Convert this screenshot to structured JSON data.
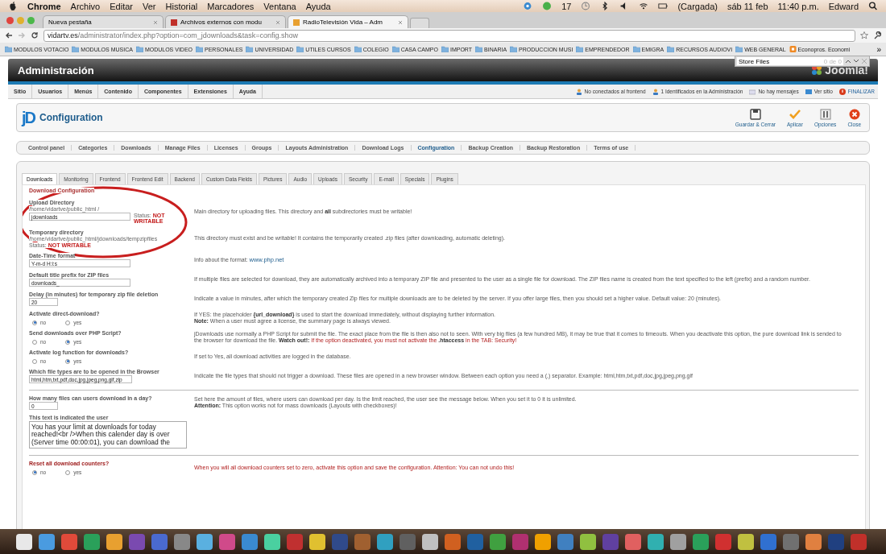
{
  "menubar": {
    "app": "Chrome",
    "menus": [
      "Archivo",
      "Editar",
      "Ver",
      "Historial",
      "Marcadores",
      "Ventana",
      "Ayuda"
    ],
    "status": [
      "17",
      "(Cargada)",
      "sáb 11 feb",
      "11:40 p.m.",
      "Edward"
    ]
  },
  "browser_tabs": [
    {
      "title": "Nueva pestaña",
      "selected": false
    },
    {
      "title": "Archivos externos con modu",
      "selected": false
    },
    {
      "title": "RadioTelevisión Vida – Adm",
      "selected": true
    }
  ],
  "address": {
    "host": "vidartv.es",
    "path": "/administrator/index.php?option=com_jdownloads&task=config.show"
  },
  "bookmarks": [
    {
      "label": "MODULOS VOTACIO",
      "kind": "folder"
    },
    {
      "label": "MODULOS MUSICA",
      "kind": "folder"
    },
    {
      "label": "MODULOS VIDEO",
      "kind": "folder"
    },
    {
      "label": "PERSONALES",
      "kind": "folder"
    },
    {
      "label": "UNIVERSIDAD",
      "kind": "folder"
    },
    {
      "label": "UTILES CURSOS",
      "kind": "folder"
    },
    {
      "label": "COLEGIO",
      "kind": "folder"
    },
    {
      "label": "CASA CAMPO",
      "kind": "folder"
    },
    {
      "label": "IMPORT",
      "kind": "folder"
    },
    {
      "label": "BINARIA",
      "kind": "folder"
    },
    {
      "label": "PRODUCCION MUSI",
      "kind": "folder"
    },
    {
      "label": "EMPRENDEDOR",
      "kind": "folder"
    },
    {
      "label": "EMIGRA",
      "kind": "folder"
    },
    {
      "label": "RECURSOS AUDIOVI",
      "kind": "folder"
    },
    {
      "label": "WEB GENERAL",
      "kind": "folder"
    },
    {
      "label": "Econopros. Economi",
      "kind": "site"
    }
  ],
  "bookmarks_more": "»",
  "find_bar": {
    "value": "Store Files",
    "count": "0 de 0"
  },
  "admin": {
    "title": "Administración",
    "logo": "Joomla!",
    "menu": [
      "Sitio",
      "Usuarios",
      "Menús",
      "Contenido",
      "Componentes",
      "Extensiones",
      "Ayuda"
    ],
    "status": [
      {
        "text": "No conectados al frontend",
        "kind": "users"
      },
      {
        "text": "1 Identificados en la Administración",
        "kind": "users"
      },
      {
        "text": "No hay mensajes",
        "kind": "mail"
      },
      {
        "text": "Ver sitio",
        "kind": "site"
      },
      {
        "text": "FINALIZAR",
        "kind": "logout"
      }
    ]
  },
  "toolbar": {
    "logo": "jD",
    "title": "Configuration",
    "buttons": [
      {
        "label": "Guardar & Cerrar",
        "kind": "save"
      },
      {
        "label": "Aplicar",
        "kind": "apply"
      },
      {
        "label": "Opciones",
        "kind": "options"
      },
      {
        "label": "Close",
        "kind": "close"
      }
    ]
  },
  "submenu": [
    {
      "label": "Control panel",
      "selected": false
    },
    {
      "label": "Categories",
      "selected": false
    },
    {
      "label": "Downloads",
      "selected": false
    },
    {
      "label": "Manage Files",
      "selected": false
    },
    {
      "label": "Licenses",
      "selected": false
    },
    {
      "label": "Groups",
      "selected": false
    },
    {
      "label": "Layouts Administration",
      "selected": false
    },
    {
      "label": "Download Logs",
      "selected": false
    },
    {
      "label": "Configuration",
      "selected": true
    },
    {
      "label": "Backup Creation",
      "selected": false
    },
    {
      "label": "Backup Restoration",
      "selected": false
    },
    {
      "label": "Terms of use",
      "selected": false
    }
  ],
  "config_tabs": [
    {
      "label": "Downloads",
      "selected": true
    },
    {
      "label": "Monitoring",
      "selected": false
    },
    {
      "label": "Frontend",
      "selected": false
    },
    {
      "label": "Frontend Edit",
      "selected": false
    },
    {
      "label": "Backend",
      "selected": false
    },
    {
      "label": "Custom Data Fields",
      "selected": false
    },
    {
      "label": "Pictures",
      "selected": false
    },
    {
      "label": "Audio",
      "selected": false
    },
    {
      "label": "Uploads",
      "selected": false
    },
    {
      "label": "Security",
      "selected": false
    },
    {
      "label": "E-mail",
      "selected": false
    },
    {
      "label": "Specials",
      "selected": false
    },
    {
      "label": "Plugins",
      "selected": false
    }
  ],
  "section_title": "Download Configuration",
  "rows": [
    {
      "kind": "text",
      "label": "Upload Directory",
      "path": "/home/vidartve/public_html /",
      "value": "jdownloads",
      "status_label": "Status:",
      "status": "NOT WRITABLE",
      "description": [
        "Main directory for uploading files. This directory and **all** subdirectories must be writable!"
      ]
    },
    {
      "kind": "info",
      "label": "Temporary directory",
      "path": "/home/vidartve/public_html/jdownloads/tempzipfiles",
      "status_label": "Status:",
      "status": "NOT WRITABLE",
      "description": [
        "This directory must exist and be writable! It contains the temporarily created .zip files (after downloading, automatic deleting)."
      ]
    },
    {
      "kind": "text",
      "label": "Date-Time format",
      "value": "Y-m-d H:i:s",
      "description": [
        "Info about the format:"
      ],
      "link": "www.php.net"
    },
    {
      "kind": "text",
      "label": "Default title prefix for ZIP files",
      "value": "downloads_",
      "description": [
        "If multiple files are selected for download, they are automatically archived into a temporary ZIP file and presented to the user as a single file for download. The ZIP files name is created from the text specified to the left (prefix) and a random number."
      ]
    },
    {
      "kind": "short",
      "label": "Delay (in minutes) for temporary zip file deletion",
      "value": "20",
      "description": [
        "Indicate a value in minutes, after which the temporary created Zip files for multiple downloads are to be deleted by the server. If you offer large files, then you should set a higher value. Default value: 20 (minutes)."
      ]
    },
    {
      "kind": "radio",
      "label": "Activate direct-download?",
      "options": [
        {
          "label": "no",
          "selected": true
        },
        {
          "label": "yes",
          "selected": false
        }
      ],
      "description": [
        "If YES: the placeholder **{url_download}** is used to start the download immediately, without displaying further information.",
        "**Note:** When a user must agree a license, the summary page is always viewed."
      ]
    },
    {
      "kind": "radio",
      "label": "Send downloads over PHP Script?",
      "options": [
        {
          "label": "no",
          "selected": false
        },
        {
          "label": "yes",
          "selected": true
        }
      ],
      "description": [
        "jDownloads use normally a PHP Script for submit the file. The exact place from the file is then also not to seen. With very big files (a few hundred MB), it may be true that it comes to timeouts. When you deactivate this option, the pure download link is sended to the browser for download the file."
      ],
      "warning": "**Watch out!:** If the option deactivated, you must not activate the **.htaccess** in the TAB: Security!"
    },
    {
      "kind": "radio",
      "label": "Activate log function for downloads?",
      "options": [
        {
          "label": "no",
          "selected": false
        },
        {
          "label": "yes",
          "selected": true
        }
      ],
      "description": [
        "If set to Yes, all download activities are logged in the database."
      ]
    },
    {
      "kind": "wide",
      "label": "Which file types are to be opened in the Browser",
      "value": "html,htm,txt,pdf,doc,jpg,jpeg,png,gif,zip",
      "separator_after": true,
      "description": [
        "Indicate the file types that should not trigger a download. These files are opened in a new browser window. Between each option you need a (,) separator. Example: html,htm,txt,pdf,doc,jpg,jpeg,png,gif"
      ]
    },
    {
      "kind": "short",
      "label": "How many files can users download in a day?",
      "value": "0",
      "description": [
        "Set here the amount of files, where users can download per day. Is the limit reached, the user see the message below. When you set it to 0 it is unlimited.",
        "**Attention:** This option works not for mass downloads (Layouts with checkboxes)!"
      ]
    },
    {
      "kind": "textarea",
      "label": "This text is indicated the user",
      "value": "You has your limit at downloads for today reached!<br />When this calender day is over (Server time 00:00:01), you can download the",
      "separator_after": true
    },
    {
      "kind": "radio",
      "label": "Reset all download counters?",
      "alert": true,
      "options": [
        {
          "label": "no",
          "selected": true
        },
        {
          "label": "yes",
          "selected": false
        }
      ],
      "description": [
        "When you will all download counters set to zero, activate this option and save the configuration. Attention: You can not undo this!"
      ]
    }
  ]
}
